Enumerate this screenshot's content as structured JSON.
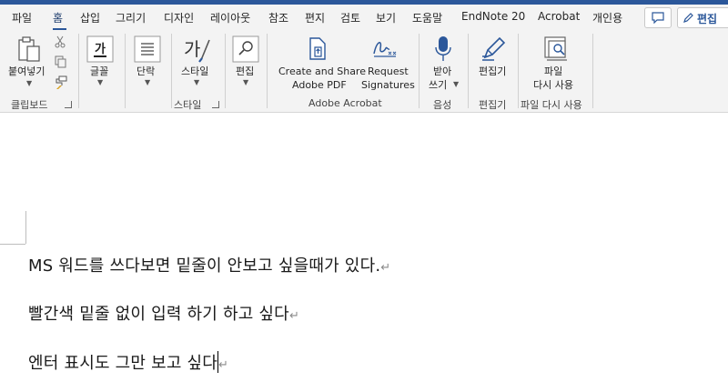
{
  "ribbon_tabs": [
    {
      "label": "파일"
    },
    {
      "label": "홈"
    },
    {
      "label": "삽입"
    },
    {
      "label": "그리기"
    },
    {
      "label": "디자인"
    },
    {
      "label": "레이아웃"
    },
    {
      "label": "참조"
    },
    {
      "label": "편지"
    },
    {
      "label": "검토"
    },
    {
      "label": "보기"
    },
    {
      "label": "도움말"
    },
    {
      "label": "EndNote 20"
    },
    {
      "label": "Acrobat"
    },
    {
      "label": "개인용"
    }
  ],
  "active_tab": "홈",
  "editing_mode_label": "편집",
  "groups": {
    "clipboard": {
      "label": "클립보드",
      "paste_label": "붙여넣기"
    },
    "font": {
      "button_label": "글꼴"
    },
    "paragraph": {
      "button_label": "단락"
    },
    "styles": {
      "label": "스타일",
      "button_label": "스타일"
    },
    "editing": {
      "button_label": "편집"
    },
    "adobe_acrobat": {
      "label": "Adobe Acrobat",
      "create_share_line1": "Create and Share",
      "create_share_line2": "Adobe PDF",
      "request_sig_line1": "Request",
      "request_sig_line2": "Signatures"
    },
    "voice": {
      "label": "음성",
      "dictate_line1": "받아",
      "dictate_line2": "쓰기"
    },
    "editor": {
      "label": "편집기",
      "button_label": "편집기"
    },
    "reuse_files": {
      "label": "파일 다시 사용",
      "line1": "파일",
      "line2": "다시 사용"
    }
  },
  "document": {
    "paragraphs": [
      "MS 워드를 쓰다보면 밑줄이 안보고 싶을때가 있다.",
      "빨간색 밑줄 없이 입력 하기 하고 싶다",
      "엔터 표시도 그만 보고 싶다"
    ],
    "paragraph_mark": "↵"
  },
  "colors": {
    "accent": "#2b579a",
    "ribbon_bg": "#f3f3f3"
  }
}
